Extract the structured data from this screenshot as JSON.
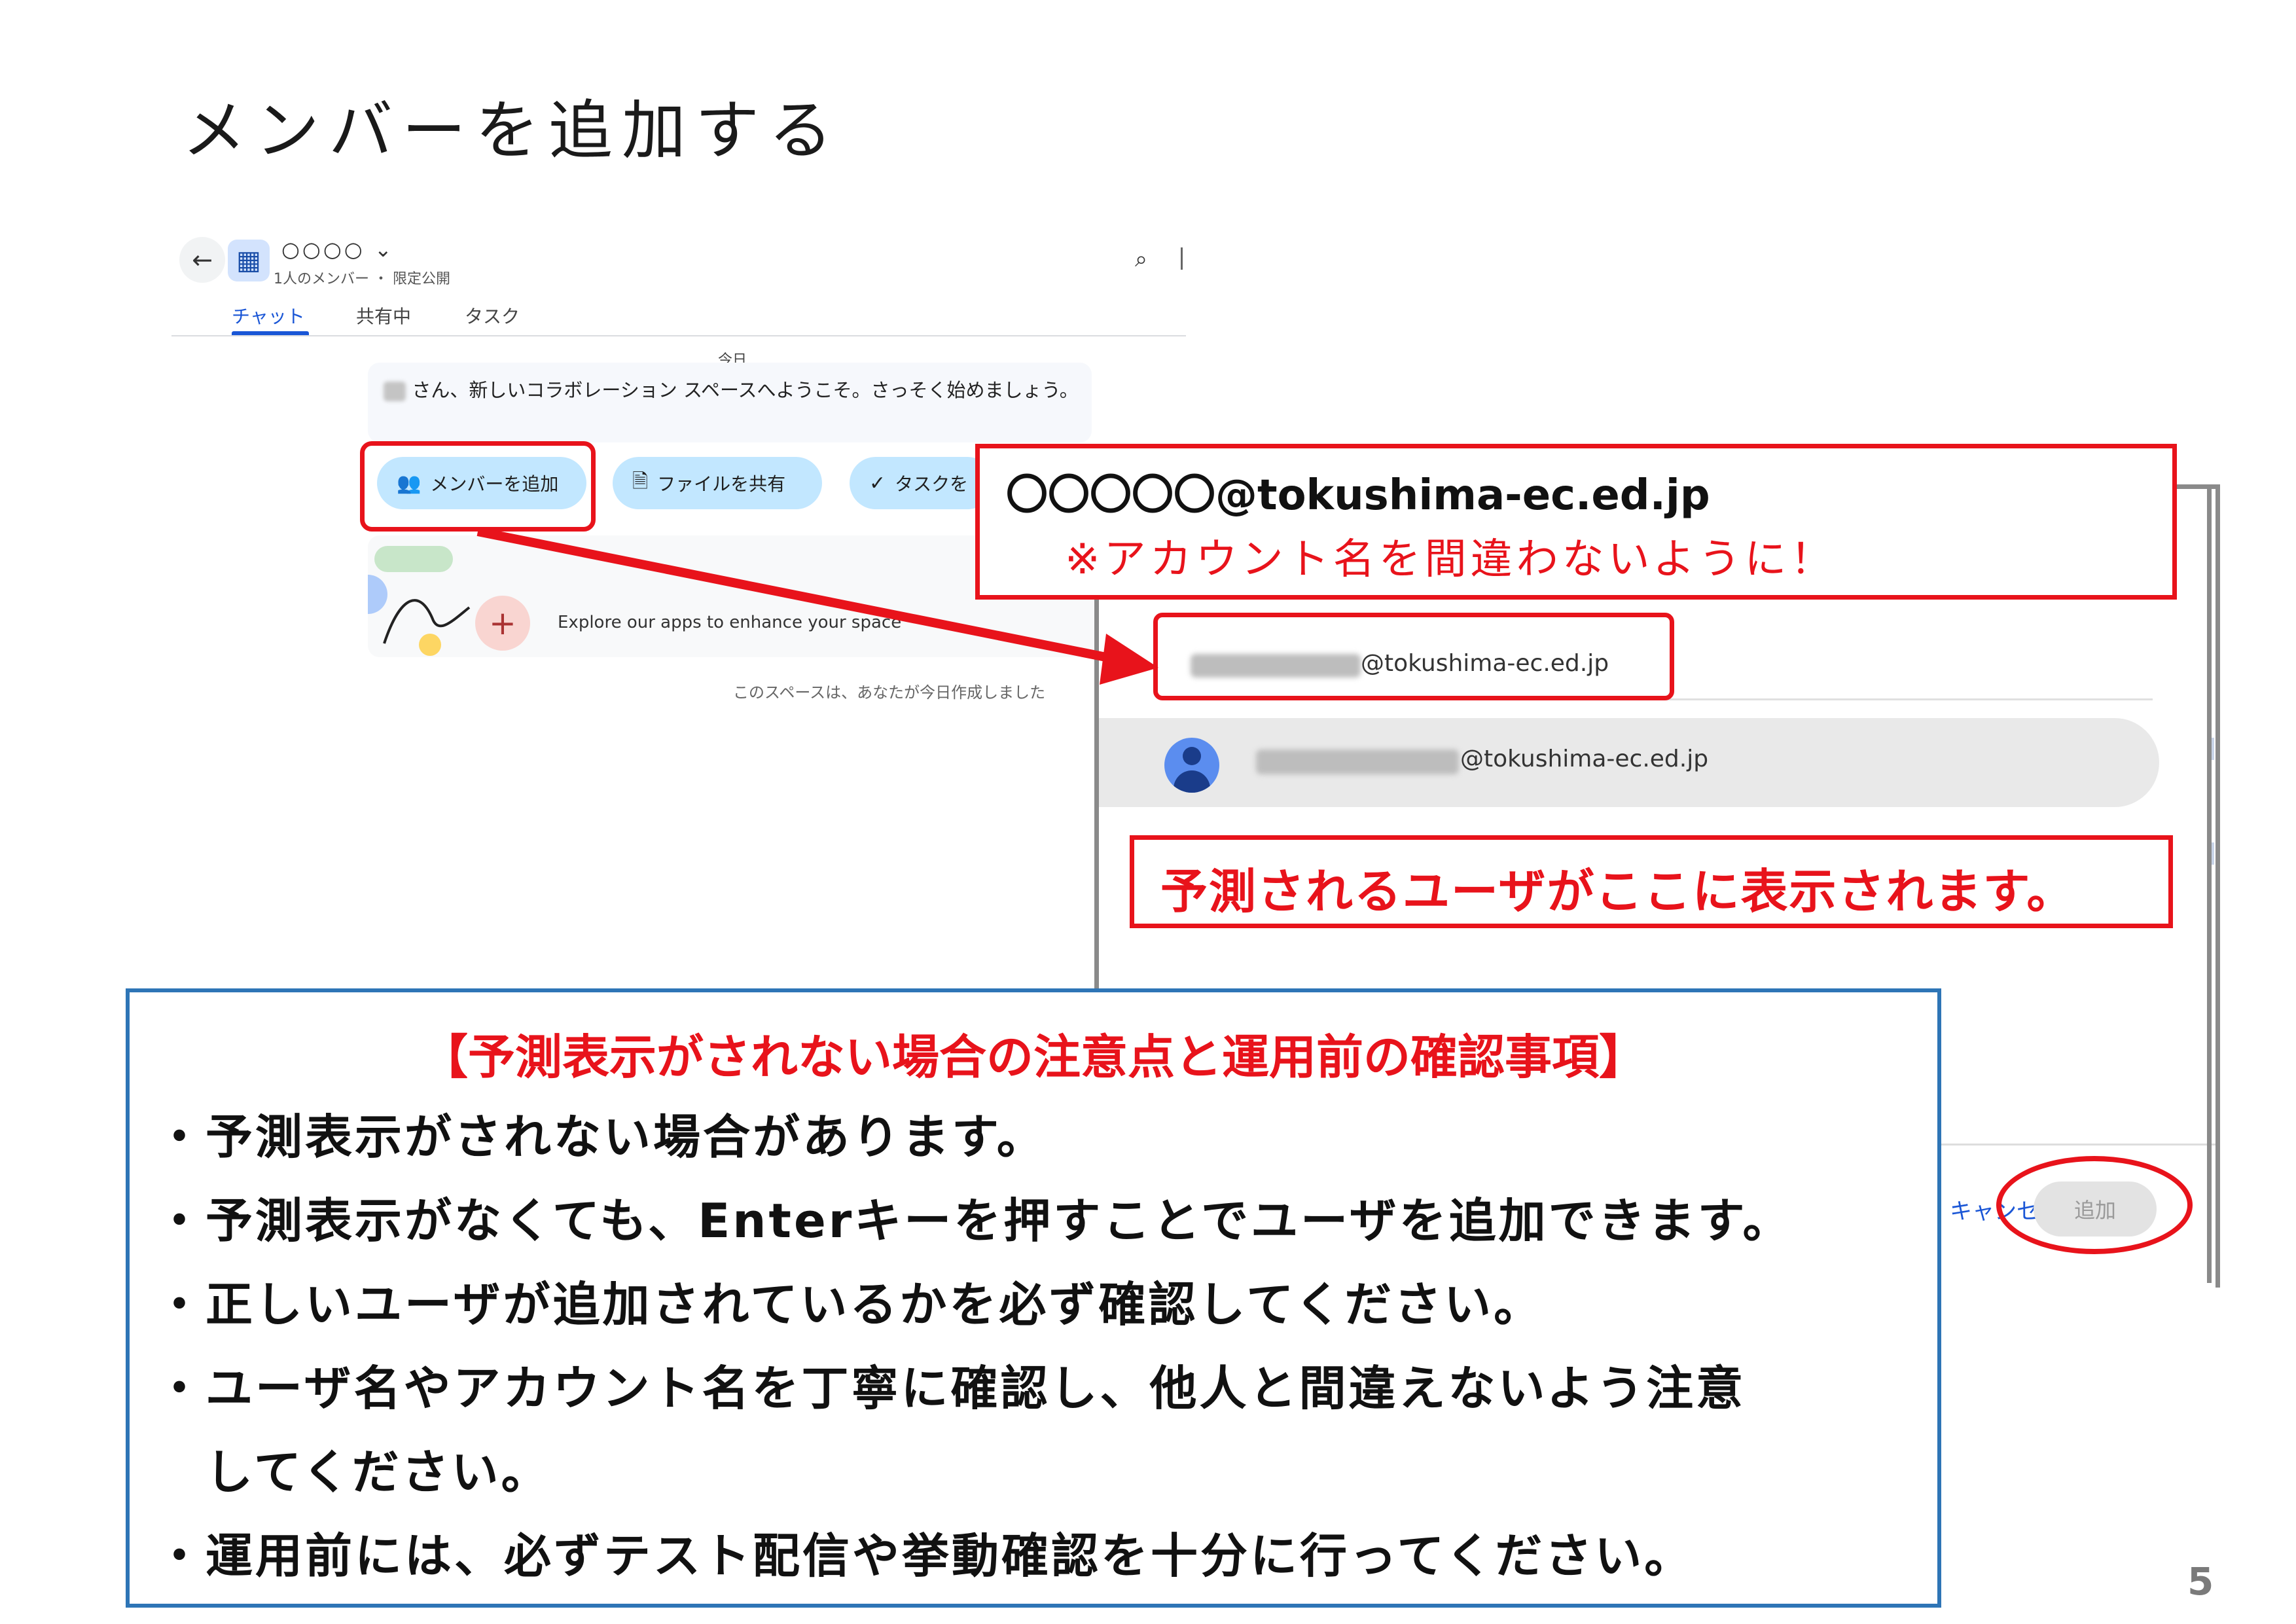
{
  "slide": {
    "title": "メンバーを追加する",
    "page_number": "5"
  },
  "chat_window": {
    "space_name": "○○○○ ⌄",
    "space_subtitle": "1人のメンバー ・ 限定公開",
    "tabs": [
      {
        "label": "チャット",
        "active": true
      },
      {
        "label": "共有中",
        "active": false
      },
      {
        "label": "タスク",
        "active": false
      }
    ],
    "date_divider": "今日",
    "welcome_message": "さん、新しいコラボレーション スペースへようこそ。さっそく始めましょう。",
    "actions": [
      {
        "label": "メンバーを追加",
        "icon": "add-person-icon"
      },
      {
        "label": "ファイルを共有",
        "icon": "file-share-icon"
      },
      {
        "label": "タスクを",
        "icon": "task-icon"
      }
    ],
    "explore_text": "Explore our apps to enhance your space",
    "created_note": "このスペースは、あなたが今日作成しました"
  },
  "add_dialog": {
    "input_domain": "@tokushima-ec.ed.jp",
    "suggestion_domain": "@tokushima-ec.ed.jp",
    "cancel_label": "キャンセル",
    "add_label": "追加"
  },
  "annotations": {
    "email_format": "〇〇〇〇〇@tokushima-ec.ed.jp",
    "email_warning": "※アカウント名を間違わないように！",
    "prediction_note": "予測されるユーザがここに表示されます。"
  },
  "notes": {
    "heading": "【予測表示がされない場合の注意点と運用前の確認事項】",
    "items": [
      "・予測表示がされない場合があります。",
      "・予測表示がなくても、Enterキーを押すことでユーザを追加できます。",
      "・正しいユーザが追加されているかを必ず確認してください。",
      "・ユーザ名やアカウント名を丁寧に確認し、他人と間違えないよう注意",
      "　してください。",
      "・運用前には、必ずテスト配信や挙動確認を十分に行ってください。"
    ]
  },
  "colors": {
    "annotation_red": "#e8131b",
    "notes_border_blue": "#2e75b6",
    "accent_blue": "#1a56d6",
    "chip_blue": "#c2e7ff"
  }
}
